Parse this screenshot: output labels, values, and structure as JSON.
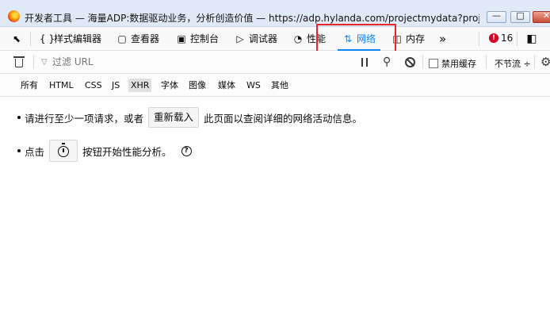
{
  "window": {
    "title": "开发者工具 — 海量ADP:数据驱动业务，分析创造价值 — https://adp.hylanda.com/projectmydata?proj...",
    "minimize_glyph": "—",
    "restore_glyph": "□",
    "close_glyph": "✕"
  },
  "toolbar": {
    "picker_icon": "element-picker-icon",
    "tabs": [
      {
        "label": "样式编辑器",
        "icon": "{ }"
      },
      {
        "label": "查看器",
        "icon": "▢"
      },
      {
        "label": "控制台",
        "icon": "▣"
      },
      {
        "label": "调试器",
        "icon": "▷"
      },
      {
        "label": "性能",
        "icon": "◔"
      },
      {
        "label": "网络",
        "icon": "⇅"
      },
      {
        "label": "内存",
        "icon": "◫"
      }
    ],
    "active_tab": "网络",
    "overflow_glyph": "»",
    "error_count": "16",
    "error_glyph": "!"
  },
  "filterbar": {
    "placeholder": "过滤 URL",
    "funnel_glyph": "▽",
    "disable_cache_label": "禁用缓存",
    "throttle_label": "不节流 ÷",
    "magnify_glyph": "⚲",
    "gear_glyph": "⚙"
  },
  "typefilters": [
    "所有",
    "HTML",
    "CSS",
    "JS",
    "XHR",
    "字体",
    "图像",
    "媒体",
    "WS",
    "其他"
  ],
  "selected_type": "XHR",
  "empty_state": {
    "line1_before": "请进行至少一项请求，或者",
    "reload_button": "重新载入",
    "line1_after": "此页面以查阅详细的网络活动信息。",
    "line2_before": "点击",
    "line2_after": "按钮开始性能分析。",
    "help_glyph": "?"
  },
  "colors": {
    "accent": "#0a84ff",
    "highlight": "#e8272b",
    "error": "#d70022"
  }
}
